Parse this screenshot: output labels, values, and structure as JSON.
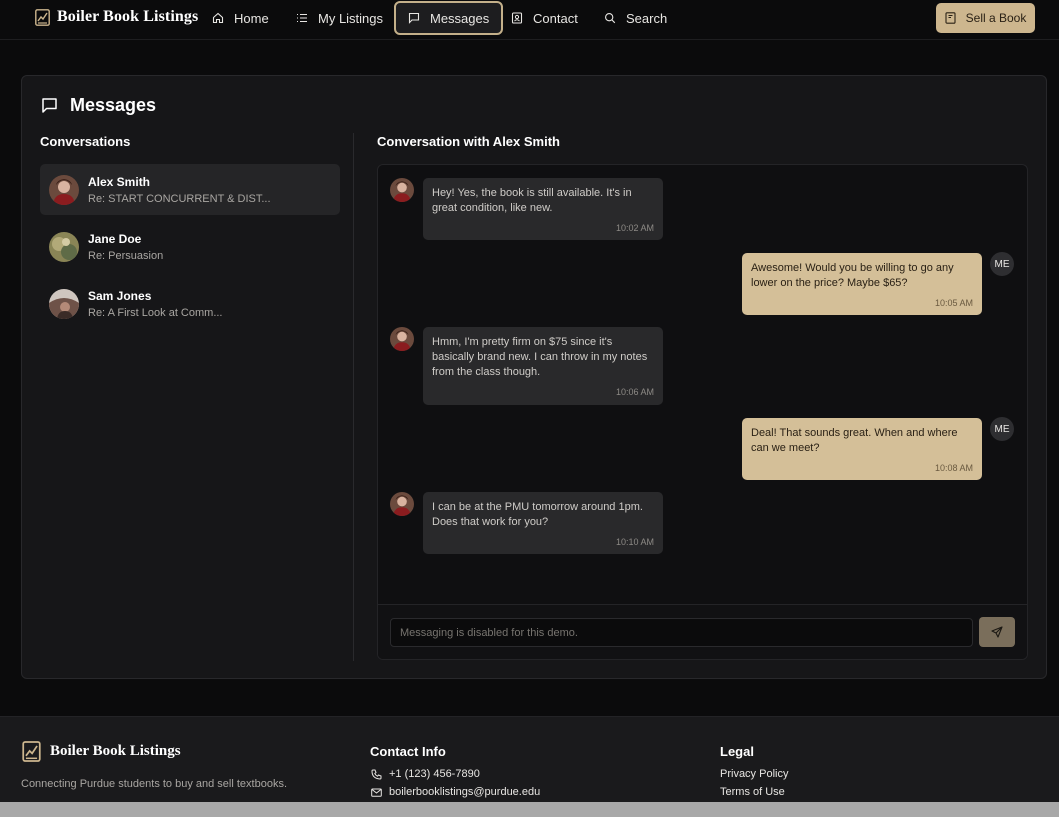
{
  "nav": {
    "brand": "Boiler Book Listings",
    "links": [
      {
        "label": "Home",
        "icon": "home-icon"
      },
      {
        "label": "My Listings",
        "icon": "list-icon"
      },
      {
        "label": "Messages",
        "icon": "message-icon",
        "active": true
      },
      {
        "label": "Contact",
        "icon": "contact-icon"
      },
      {
        "label": "Search",
        "icon": "search-icon"
      }
    ],
    "sell_label": "Sell a Book"
  },
  "page": {
    "title": "Messages",
    "conversations_heading": "Conversations",
    "chat_heading": "Conversation with Alex Smith"
  },
  "conversations": [
    {
      "name": "Alex Smith",
      "subject": "Re: START CONCURRENT & DIST...",
      "active": true
    },
    {
      "name": "Jane Doe",
      "subject": "Re: Persuasion"
    },
    {
      "name": "Sam Jones",
      "subject": "Re: A First Look at Comm..."
    }
  ],
  "messages": [
    {
      "from": "them",
      "text": "Hey! Yes, the book is still available. It's in great condition, like new.",
      "time": "10:02 AM"
    },
    {
      "from": "me",
      "text": "Awesome! Would you be willing to go any lower on the price? Maybe $65?",
      "time": "10:05 AM",
      "avatar": "ME"
    },
    {
      "from": "them",
      "text": "Hmm, I'm pretty firm on $75 since it's basically brand new. I can throw in my notes from the class though.",
      "time": "10:06 AM"
    },
    {
      "from": "me",
      "text": "Deal! That sounds great. When and where can we meet?",
      "time": "10:08 AM",
      "avatar": "ME"
    },
    {
      "from": "them",
      "text": "I can be at the PMU tomorrow around 1pm. Does that work for you?",
      "time": "10:10 AM"
    }
  ],
  "composer": {
    "placeholder": "Messaging is disabled for this demo."
  },
  "footer": {
    "brand": "Boiler Book Listings",
    "tagline": "Connecting Purdue students to buy and sell textbooks.",
    "contact_heading": "Contact Info",
    "phone": "+1 (123) 456-7890",
    "email": "boilerbooklistings@purdue.edu",
    "legal_heading": "Legal",
    "privacy": "Privacy Policy",
    "terms": "Terms of Use"
  },
  "colors": {
    "accent": "#cdb68e",
    "background": "#0b0b0c",
    "card": "#161618"
  }
}
